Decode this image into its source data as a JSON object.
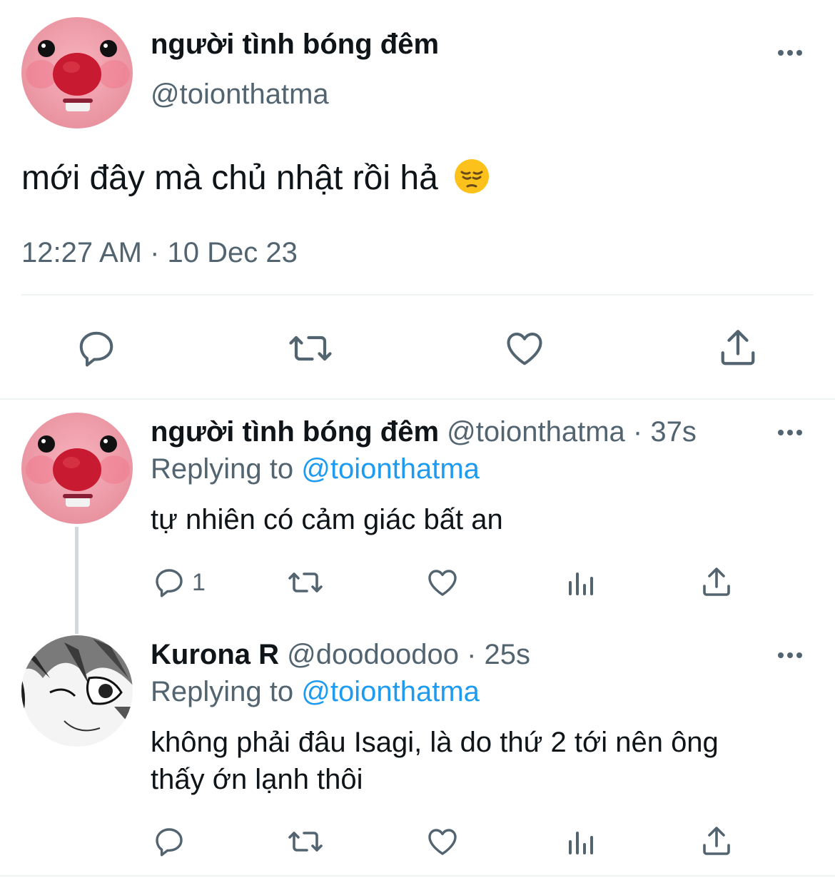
{
  "main_tweet": {
    "display_name": "người tình bóng đêm",
    "handle": "@toionthatma",
    "text": "mới đây mà chủ nhật rồi hả",
    "emoji": "😔",
    "timestamp": "12:27 AM · 10 Dec 23",
    "actions": [
      "reply-icon",
      "retweet-icon",
      "like-icon",
      "share-icon"
    ]
  },
  "replies": [
    {
      "display_name": "người tình bóng đêm",
      "handle": "@toionthatma",
      "time": "37s",
      "replying_prefix": "Replying to",
      "replying_to": "@toionthatma",
      "text": "tự nhiên có cảm giác bất an",
      "reply_count": "1"
    },
    {
      "display_name": "Kurona R",
      "handle": "@doodoodoo",
      "time": "25s",
      "replying_prefix": "Replying to",
      "replying_to": "@toionthatma",
      "text_line1": "không phải đâu Isagi, là do thứ 2 tới nên ông",
      "text_line2": "thấy ớn lạnh thôi",
      "reply_count": ""
    }
  ],
  "colors": {
    "text_primary": "#0f1419",
    "text_secondary": "#536471",
    "link": "#1d9bf0",
    "divider": "#eff3f4"
  }
}
